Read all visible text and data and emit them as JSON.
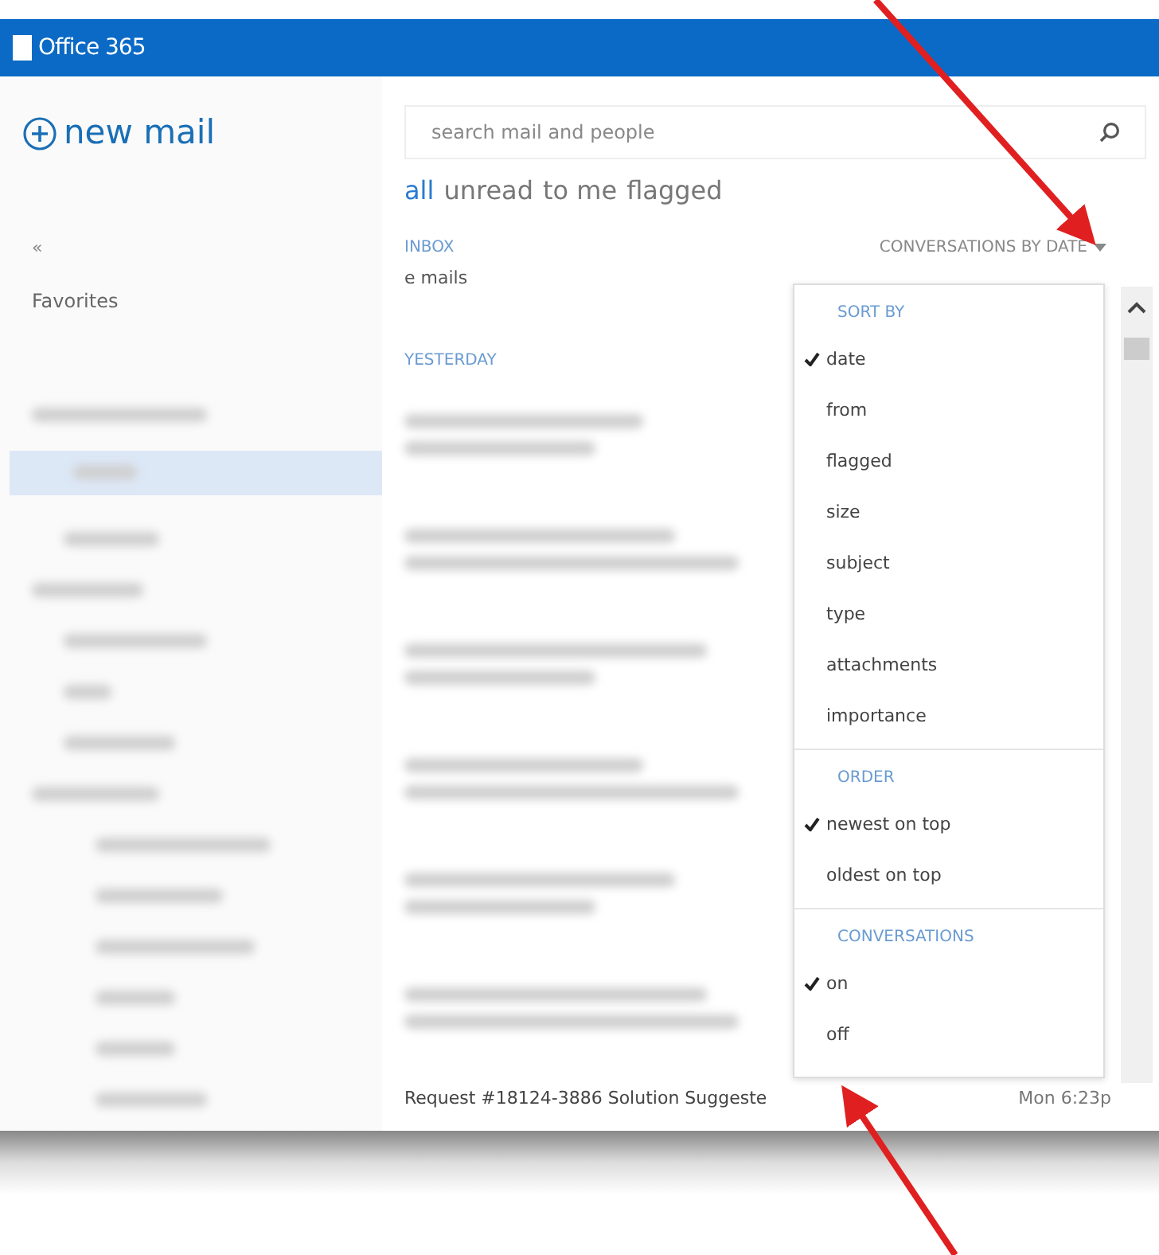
{
  "header": {
    "logo_text": "Office 365"
  },
  "new_mail": {
    "label": "new mail"
  },
  "sidebar": {
    "collapse": "«",
    "favorites": "Favorites"
  },
  "search": {
    "placeholder": "search mail and people"
  },
  "filters": [
    {
      "label": "all",
      "selected": true
    },
    {
      "label": "unread",
      "selected": false
    },
    {
      "label": "to me",
      "selected": false
    },
    {
      "label": "flagged",
      "selected": false
    }
  ],
  "folder": {
    "title": "INBOX",
    "subtitle": "e mails",
    "sort_label": "CONVERSATIONS BY DATE"
  },
  "group_header": "YESTERDAY",
  "last_message": {
    "subject": "Request #18124-3886 Solution Suggeste",
    "time": "Mon 6:23p"
  },
  "menu": {
    "sections": [
      {
        "title": "SORT BY",
        "items": [
          {
            "label": "date",
            "checked": true
          },
          {
            "label": "from",
            "checked": false
          },
          {
            "label": "flagged",
            "checked": false
          },
          {
            "label": "size",
            "checked": false
          },
          {
            "label": "subject",
            "checked": false
          },
          {
            "label": "type",
            "checked": false
          },
          {
            "label": "attachments",
            "checked": false
          },
          {
            "label": "importance",
            "checked": false
          }
        ]
      },
      {
        "title": "ORDER",
        "items": [
          {
            "label": "newest on top",
            "checked": true
          },
          {
            "label": "oldest on top",
            "checked": false
          }
        ]
      },
      {
        "title": "CONVERSATIONS",
        "items": [
          {
            "label": "on",
            "checked": true
          },
          {
            "label": "off",
            "checked": false
          }
        ]
      }
    ]
  }
}
